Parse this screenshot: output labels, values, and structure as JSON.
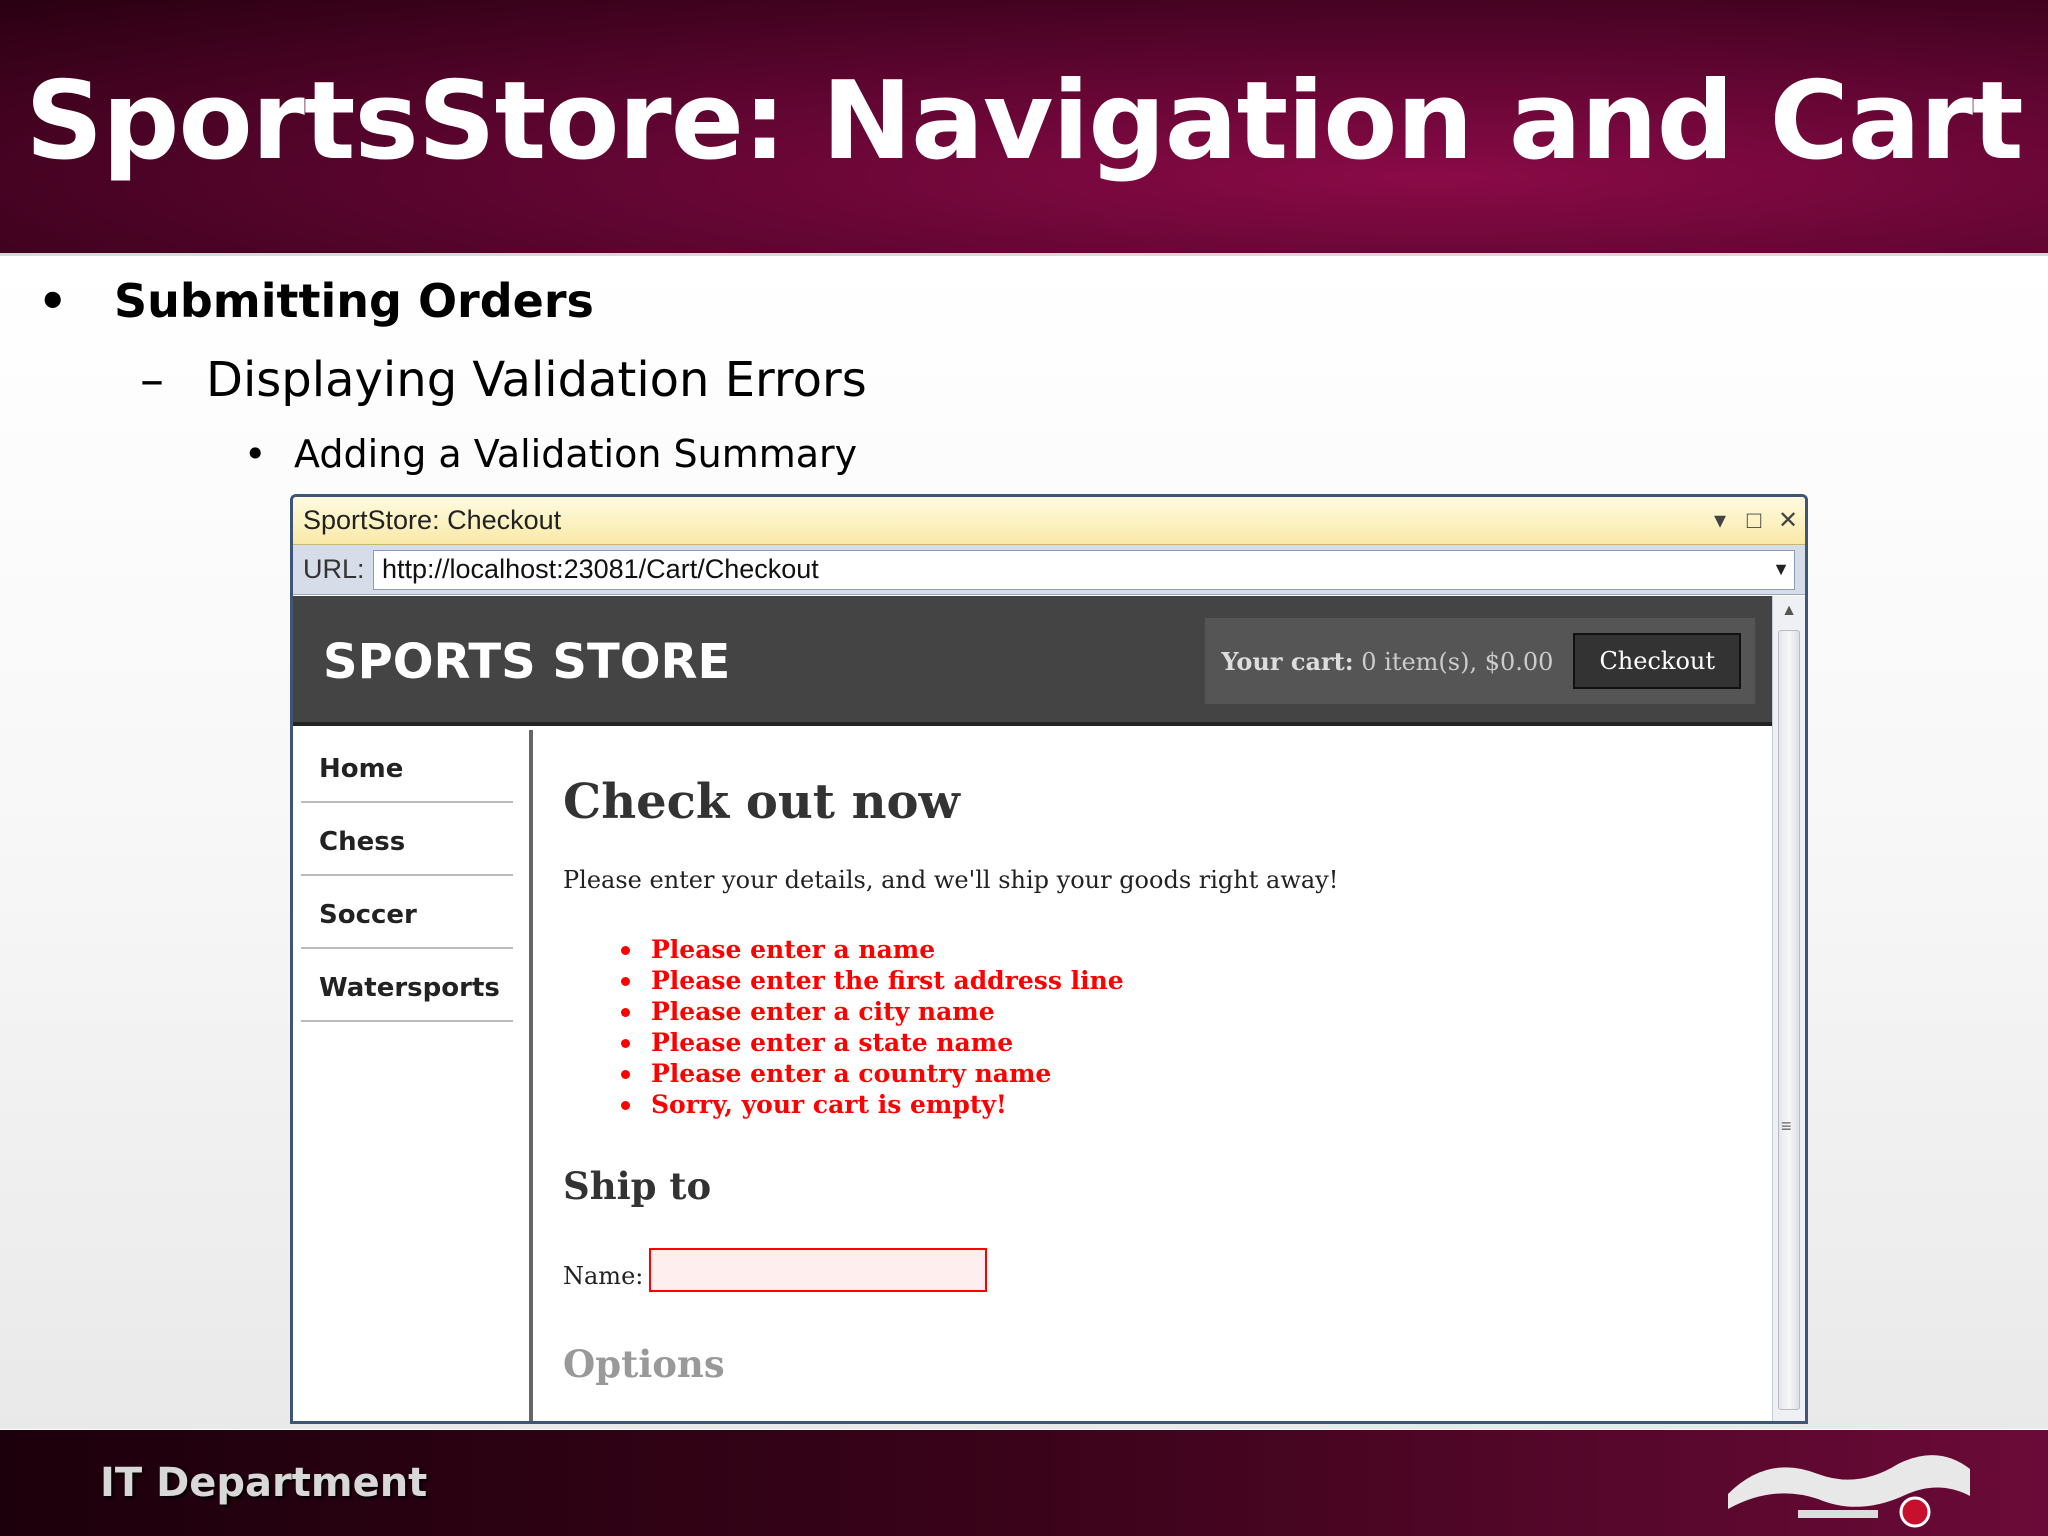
{
  "slide": {
    "title": "SportsStore: Navigation and Cart",
    "bullet_l1": "Submitting Orders",
    "bullet_l2": "Displaying Validation Errors",
    "bullet_l3": "Adding a Validation Summary",
    "footer": "IT Department"
  },
  "window": {
    "title": "SportStore: Checkout",
    "url_label": "URL:",
    "url": "http://localhost:23081/Cart/Checkout"
  },
  "site": {
    "logo": "SPORTS STORE",
    "cart_label": "Your cart:",
    "cart_value": "0 item(s), $0.00",
    "checkout_button": "Checkout",
    "nav": [
      "Home",
      "Chess",
      "Soccer",
      "Watersports"
    ]
  },
  "page": {
    "heading": "Check out now",
    "intro": "Please enter your details, and we'll ship your goods right away!",
    "errors": [
      "Please enter a name",
      "Please enter the first address line",
      "Please enter a city name",
      "Please enter a state name",
      "Please enter a country name",
      "Sorry, your cart is empty!"
    ],
    "ship_to": "Ship to",
    "name_label": "Name:",
    "name_value": "",
    "options": "Options"
  },
  "colors": {
    "accent": "#6b0a38",
    "error": "#ff0000",
    "site_header": "#444444"
  }
}
